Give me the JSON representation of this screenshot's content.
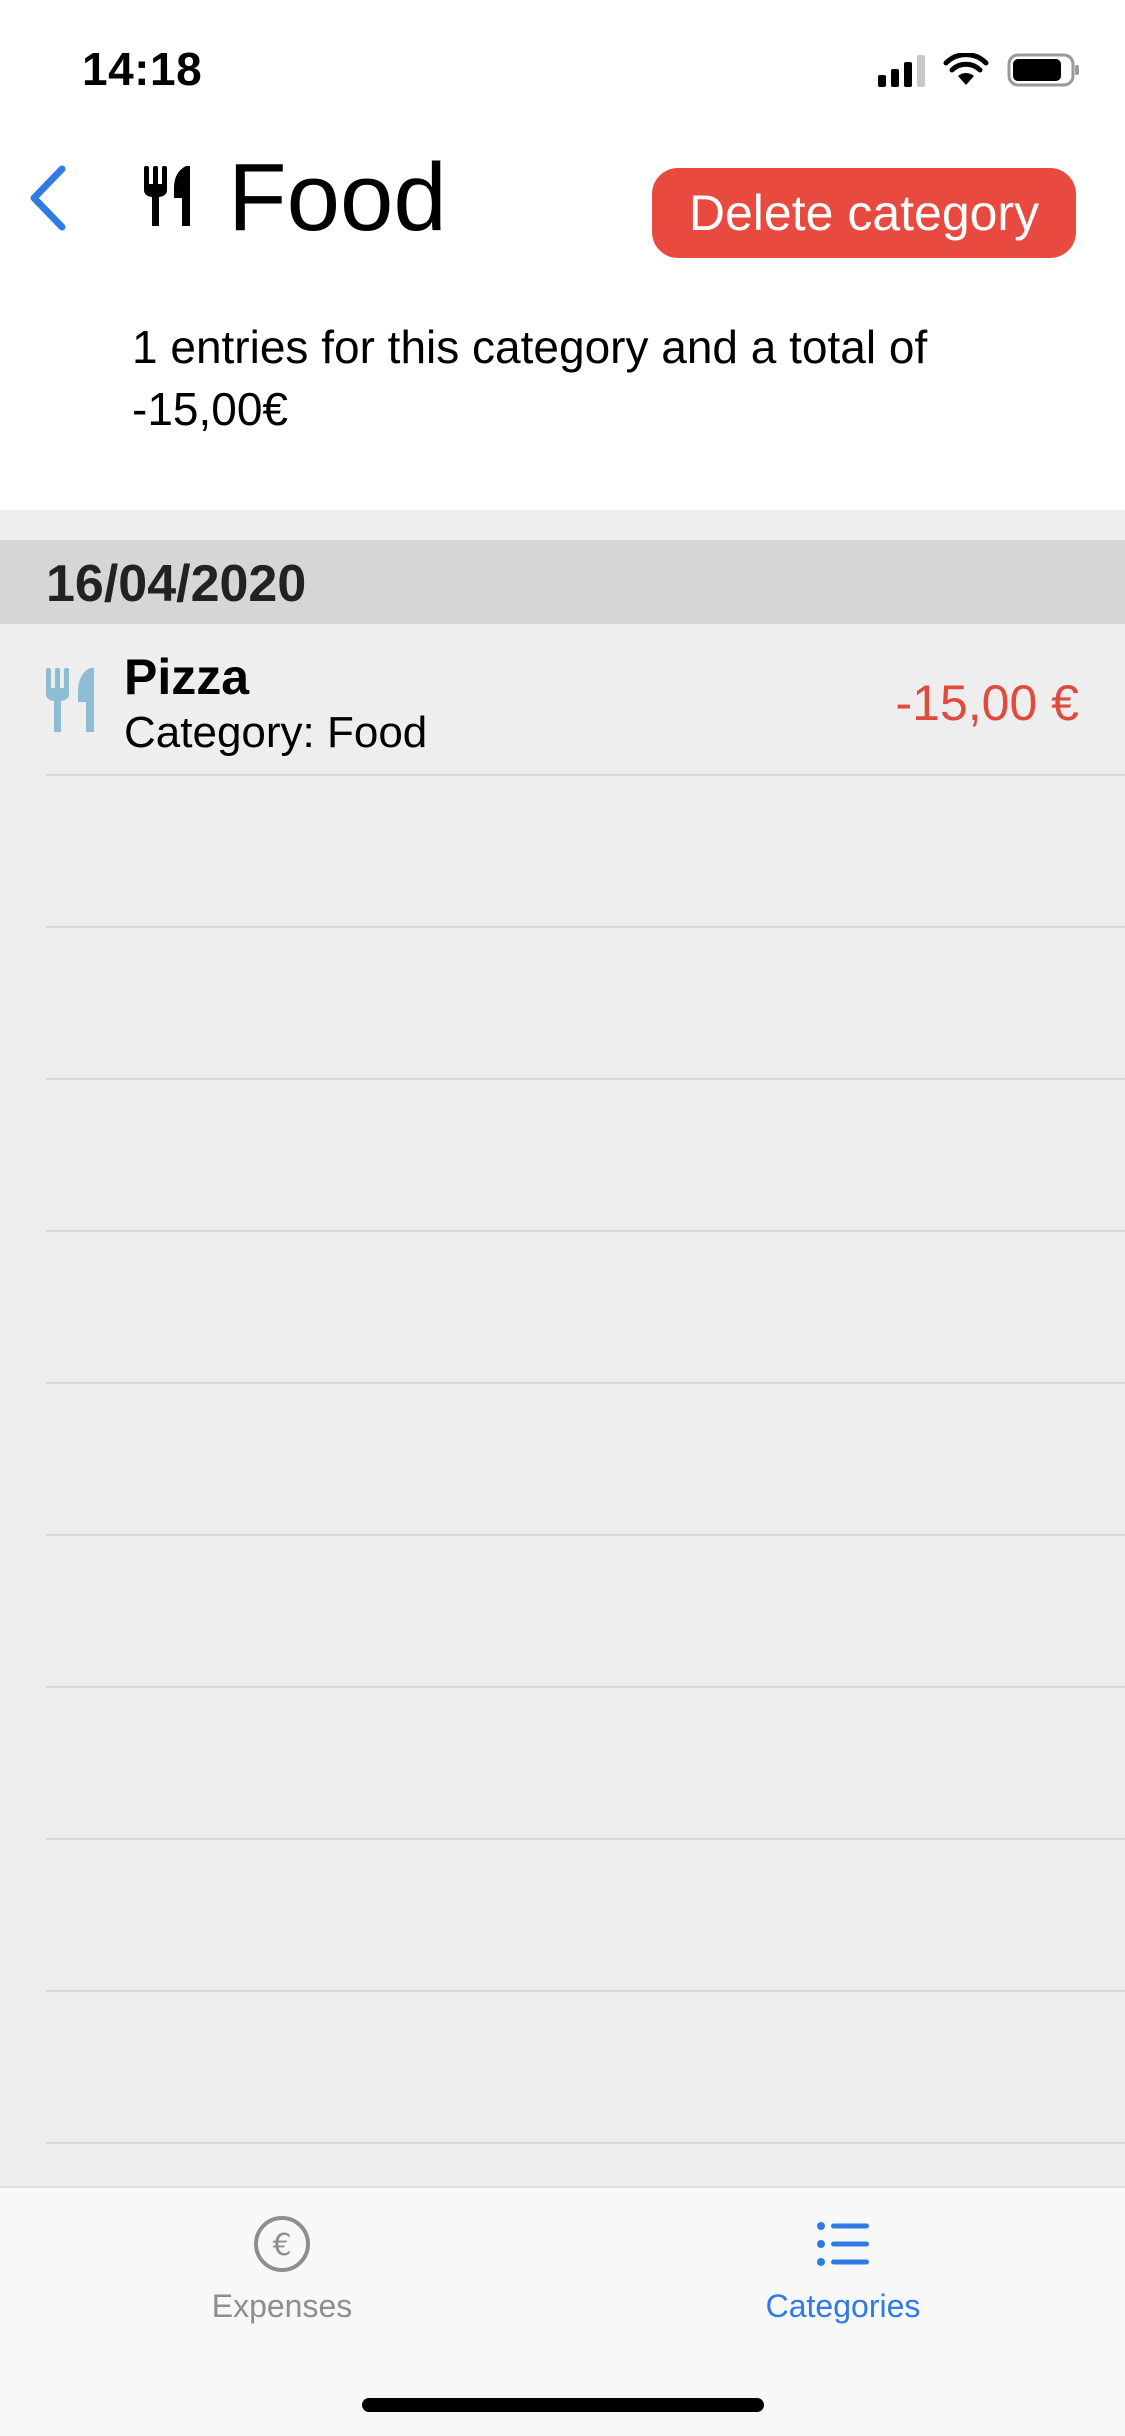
{
  "status_bar": {
    "time": "14:18",
    "battery_level": 0.85,
    "signal_bars": 3
  },
  "header": {
    "title": "Food",
    "title_icon": "fork-knife-icon",
    "back_icon": "chevron-left-icon",
    "delete_label": "Delete category",
    "summary": "1 entries for this category and a total of -15,00€"
  },
  "section": {
    "date": "16/04/2020"
  },
  "entries": [
    {
      "title": "Pizza",
      "category": "Category: Food",
      "amount": "-15,00 €",
      "icon": "fork-knife-icon"
    }
  ],
  "tab_bar": {
    "tabs": [
      {
        "label": "Expenses",
        "icon": "euro-circle-icon",
        "active": false
      },
      {
        "label": "Categories",
        "icon": "list-icon",
        "active": true
      }
    ]
  },
  "colors": {
    "accent": "#2f7ae5",
    "delete": "#e84a3f",
    "negative_amount": "#e04b3e",
    "entry_icon": "#8fbcd4"
  }
}
